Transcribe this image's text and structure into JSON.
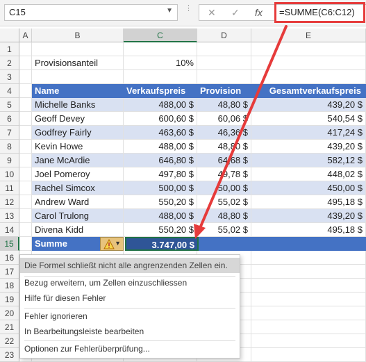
{
  "formula_bar": {
    "name_box": "C15",
    "cancel_icon": "✕",
    "enter_icon": "✓",
    "fx_label": "fx",
    "formula": "=SUMME(C6:C12)"
  },
  "columns": [
    "A",
    "B",
    "C",
    "D",
    "E"
  ],
  "rows": [
    "1",
    "2",
    "3",
    "4",
    "5",
    "6",
    "7",
    "8",
    "9",
    "10",
    "11",
    "12",
    "13",
    "14",
    "15",
    "16",
    "17",
    "18",
    "19",
    "20",
    "21",
    "22",
    "23"
  ],
  "sheet": {
    "provision_label": "Provisionsanteil",
    "provision_value": "10%",
    "headers": [
      "Name",
      "Verkaufspreis",
      "Provision",
      "Gesamtverkaufspreis"
    ],
    "data": [
      [
        "Michelle Banks",
        "488,00 $",
        "48,80 $",
        "439,20 $"
      ],
      [
        "Geoff Devey",
        "600,60 $",
        "60,06 $",
        "540,54 $"
      ],
      [
        "Godfrey Fairly",
        "463,60 $",
        "46,36 $",
        "417,24 $"
      ],
      [
        "Kevin Howe",
        "488,00 $",
        "48,80 $",
        "439,20 $"
      ],
      [
        "Jane McArdie",
        "646,80 $",
        "64,68 $",
        "582,12 $"
      ],
      [
        "Joel Pomeroy",
        "497,80 $",
        "49,78 $",
        "448,02 $"
      ],
      [
        "Rachel Simcox",
        "500,00 $",
        "50,00 $",
        "450,00 $"
      ],
      [
        "Andrew Ward",
        "550,20 $",
        "55,02 $",
        "495,18 $"
      ],
      [
        "Carol Trulong",
        "488,00 $",
        "48,80 $",
        "439,20 $"
      ],
      [
        "Divena Kidd",
        "550,20 $",
        "55,02 $",
        "495,18 $"
      ]
    ],
    "total_label": "Summe",
    "total_value": "3.747,00 $"
  },
  "error_menu": {
    "title": "Die Formel schließt nicht alle angrenzenden Zellen ein.",
    "items": [
      "Bezug erweitern, um Zellen einzuschliessen",
      "Hilfe für diesen Fehler",
      "Fehler ignorieren",
      "In Bearbeitungsleiste bearbeiten",
      "Optionen zur Fehlerüberprüfung..."
    ]
  },
  "colors": {
    "header_blue": "#4472c4",
    "band_blue": "#d9e1f2",
    "highlight_red": "#e63b3b",
    "selection_green": "#217346"
  },
  "icons": [
    "dropdown-icon",
    "cancel-icon",
    "enter-icon",
    "fx-icon",
    "warning-icon"
  ]
}
